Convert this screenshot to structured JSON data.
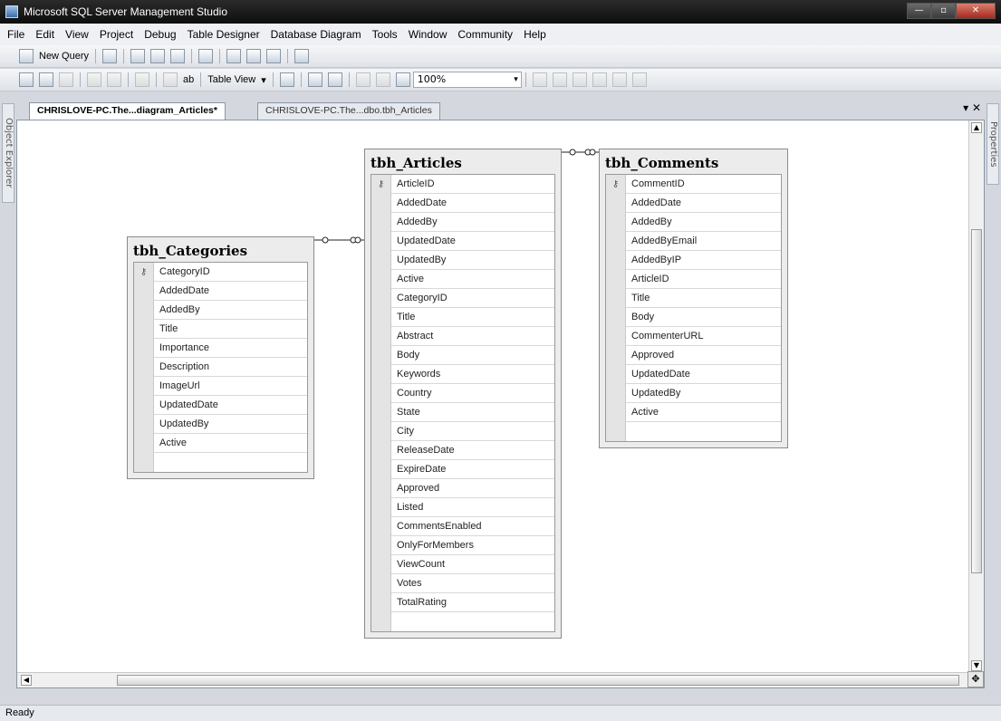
{
  "window": {
    "title": "Microsoft SQL Server Management Studio"
  },
  "menu": [
    "File",
    "Edit",
    "View",
    "Project",
    "Debug",
    "Table Designer",
    "Database Diagram",
    "Tools",
    "Window",
    "Community",
    "Help"
  ],
  "toolbar1": {
    "new_query_label": "New Query"
  },
  "toolbar2": {
    "table_view_label": "Table View",
    "zoom_value": "100%"
  },
  "side_panels": {
    "left": "Object Explorer",
    "right": "Properties"
  },
  "doc_tabs": [
    {
      "label": "CHRISLOVE-PC.The...diagram_Articles*",
      "active": true
    },
    {
      "label": "CHRISLOVE-PC.The...dbo.tbh_Articles",
      "active": false
    }
  ],
  "diagram": {
    "tables": {
      "categories": {
        "name": "tbh_Categories",
        "columns": [
          "CategoryID",
          "AddedDate",
          "AddedBy",
          "Title",
          "Importance",
          "Description",
          "ImageUrl",
          "UpdatedDate",
          "UpdatedBy",
          "Active"
        ],
        "primary_key": "CategoryID"
      },
      "articles": {
        "name": "tbh_Articles",
        "columns": [
          "ArticleID",
          "AddedDate",
          "AddedBy",
          "UpdatedDate",
          "UpdatedBy",
          "Active",
          "CategoryID",
          "Title",
          "Abstract",
          "Body",
          "Keywords",
          "Country",
          "State",
          "City",
          "ReleaseDate",
          "ExpireDate",
          "Approved",
          "Listed",
          "CommentsEnabled",
          "OnlyForMembers",
          "ViewCount",
          "Votes",
          "TotalRating"
        ],
        "primary_key": "ArticleID"
      },
      "comments": {
        "name": "tbh_Comments",
        "columns": [
          "CommentID",
          "AddedDate",
          "AddedBy",
          "AddedByEmail",
          "AddedByIP",
          "ArticleID",
          "Title",
          "Body",
          "CommenterURL",
          "Approved",
          "UpdatedDate",
          "UpdatedBy",
          "Active"
        ],
        "primary_key": "CommentID"
      }
    }
  },
  "status": {
    "text": "Ready"
  },
  "colors": {
    "title_bar": "#1a1a1a",
    "canvas": "#ffffff",
    "table_header": "#ececec"
  }
}
